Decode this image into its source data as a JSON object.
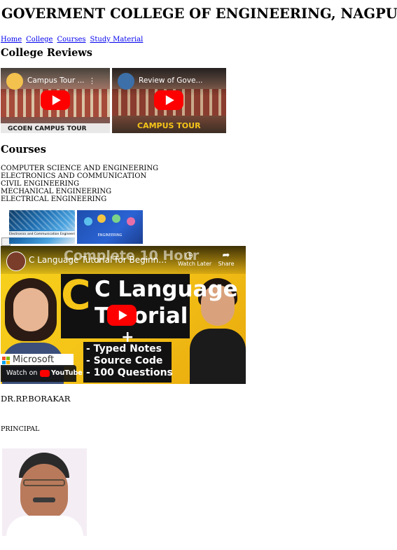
{
  "header": {
    "title": "GOVERMENT COLLEGE OF ENGINEERING, NAGPUR"
  },
  "nav": {
    "items": [
      {
        "label": "Home"
      },
      {
        "label": "College"
      },
      {
        "label": "Courses"
      },
      {
        "label": "Study Material"
      }
    ]
  },
  "reviews": {
    "heading": "College Reviews",
    "videos": [
      {
        "title": "Campus Tour ...",
        "caption": "GCOEN CAMPUS TOUR"
      },
      {
        "title": "Review of Gove...",
        "caption": "CAMPUS TOUR"
      }
    ]
  },
  "courses": {
    "heading": "Courses",
    "list": [
      "COMPUTER SCIENCE AND ENGINEERING",
      "ELECTRONICS AND COMMUNICATION",
      "CIVIL ENGINEERING",
      "MECHANICAL ENGINEERING",
      "ELECTRICAL ENGINEERING"
    ],
    "images": [
      {
        "caption": "Electronics and Communication Engineering"
      },
      {
        "caption": "ENGINEERING"
      }
    ]
  },
  "tutorial_video": {
    "title": "C Language Tutorial for Beginners (wit...",
    "watch_later": "Watch Later",
    "share": "Share",
    "banner_top": "Complete 10 Hour",
    "line1": "C Language",
    "line2": "Tutorial",
    "plus": "+",
    "bullets": [
      "- Typed Notes",
      "- Source Code",
      "- 100 Questions"
    ],
    "brand": "Microsoft",
    "watch_on": "Watch on",
    "youtube": "YouTube"
  },
  "principal": {
    "name": "DR.RP.BORAKAR",
    "role": "PRINCIPAL"
  },
  "colors": {
    "link": "#0000ee",
    "youtube_red": "#ff0000",
    "thumb_yellow": "#f5c518"
  }
}
